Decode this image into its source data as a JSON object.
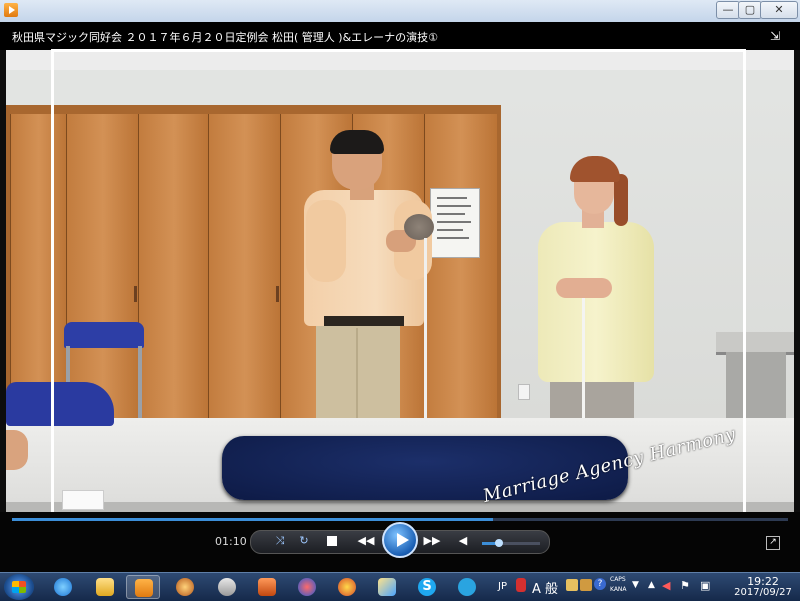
{
  "window": {
    "minimize_label": "—",
    "maximize_label": "▢",
    "close_label": "✕"
  },
  "video": {
    "title": "秋田県マジック同好会 ２０１７年６月２０日定例会 松田( 管理人 )&エレーナの演技①",
    "notice_text": "",
    "watermark": "Marriage Agency Harmony"
  },
  "player": {
    "current_time": "01:10",
    "seek_progress": 0.62,
    "volume": 0.3,
    "icons": [
      "shuffle-icon",
      "repeat-icon",
      "stop-icon",
      "previous-icon",
      "play-icon",
      "next-icon",
      "volume-icon",
      "fullscreen-toggle-icon",
      "switch-to-minimode-icon"
    ]
  },
  "taskbar": {
    "items": [
      "start-button",
      "internet-explorer",
      "file-explorer",
      "media-player",
      "app-4",
      "app-5",
      "app-6",
      "app-7",
      "app-8",
      "app-9",
      "skype",
      "app-11"
    ],
    "lang": "JP",
    "ime_mode": "A 般",
    "caps": "CAPS",
    "kana": "KANA",
    "clock_time": "19:22",
    "clock_date": "2017/09/27"
  }
}
